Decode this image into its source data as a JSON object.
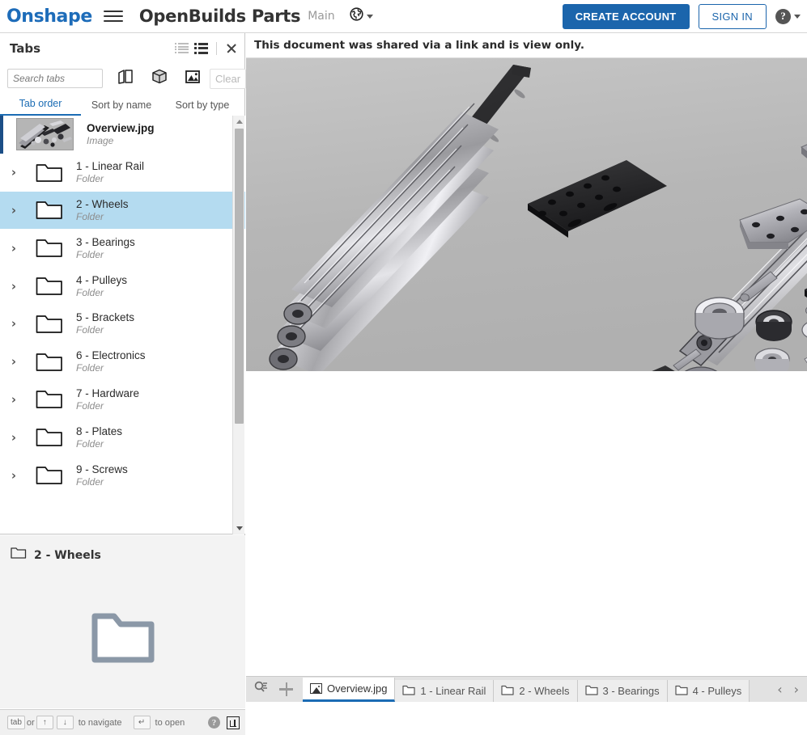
{
  "header": {
    "brand": "Onshape",
    "menu_icon": "hamburger-icon",
    "document_title": "OpenBuilds Parts",
    "branch": "Main",
    "globe_icon": "globe-icon",
    "create_account_label": "CREATE ACCOUNT",
    "sign_in_label": "SIGN IN",
    "help_label": "?"
  },
  "sidebar": {
    "title": "Tabs",
    "close_icon": "close-icon",
    "view_plain_icon": "list-view-icon",
    "view_detail_icon": "detail-list-view-icon",
    "search": {
      "placeholder": "Search tabs",
      "value": ""
    },
    "filters": [
      {
        "name": "part-studio-filter-icon"
      },
      {
        "name": "assembly-filter-icon"
      },
      {
        "name": "image-filter-icon"
      }
    ],
    "clear_label": "Clear",
    "sort_tabs": [
      {
        "label": "Tab order",
        "active": true
      },
      {
        "label": "Sort by name",
        "active": false
      },
      {
        "label": "Sort by type",
        "active": false
      }
    ],
    "items": [
      {
        "name": "Overview.jpg",
        "type": "Image",
        "kind": "image",
        "state": "active"
      },
      {
        "name": "1 - Linear Rail",
        "type": "Folder",
        "kind": "folder",
        "state": "normal"
      },
      {
        "name": "2 - Wheels",
        "type": "Folder",
        "kind": "folder",
        "state": "selected"
      },
      {
        "name": "3 - Bearings",
        "type": "Folder",
        "kind": "folder",
        "state": "normal"
      },
      {
        "name": "4 - Pulleys",
        "type": "Folder",
        "kind": "folder",
        "state": "normal"
      },
      {
        "name": "5 - Brackets",
        "type": "Folder",
        "kind": "folder",
        "state": "normal"
      },
      {
        "name": "6 - Electronics",
        "type": "Folder",
        "kind": "folder",
        "state": "normal"
      },
      {
        "name": "7 - Hardware",
        "type": "Folder",
        "kind": "folder",
        "state": "normal"
      },
      {
        "name": "8 - Plates",
        "type": "Folder",
        "kind": "folder",
        "state": "normal"
      },
      {
        "name": "9 - Screws",
        "type": "Folder",
        "kind": "folder",
        "state": "normal"
      }
    ]
  },
  "preview": {
    "title": "2 - Wheels",
    "folder_icon": "folder-icon-large"
  },
  "hintbar": {
    "key_tab": "tab",
    "or_label": "or",
    "key_up": "↑",
    "key_down": "↓",
    "navigate_label": "to navigate",
    "key_enter": "↵",
    "open_label": "to open",
    "help_label": "?",
    "panel_icon": "panel-toggle-icon"
  },
  "main": {
    "share_notice": "This document was shared via a link and is view only.",
    "image_alt": "OpenBuilds CNC parts exploded render"
  },
  "tabbar": {
    "search_icon": "tab-search-icon",
    "add_icon": "add-tab-icon",
    "tabs": [
      {
        "label": "Overview.jpg",
        "icon": "image-icon",
        "active": true
      },
      {
        "label": "1 - Linear Rail",
        "icon": "folder-icon",
        "active": false
      },
      {
        "label": "2 - Wheels",
        "icon": "folder-icon",
        "active": false
      },
      {
        "label": "3 - Bearings",
        "icon": "folder-icon",
        "active": false
      },
      {
        "label": "4 - Pulleys",
        "icon": "folder-icon",
        "active": false
      }
    ],
    "prev_icon": "‹",
    "next_icon": "›"
  },
  "colors": {
    "brand_blue": "#1d6cb9",
    "button_blue": "#1b65ac",
    "selection_blue": "#b4dbf0",
    "active_border": "#1b4e86",
    "image_bg": "#b9b9b9"
  }
}
